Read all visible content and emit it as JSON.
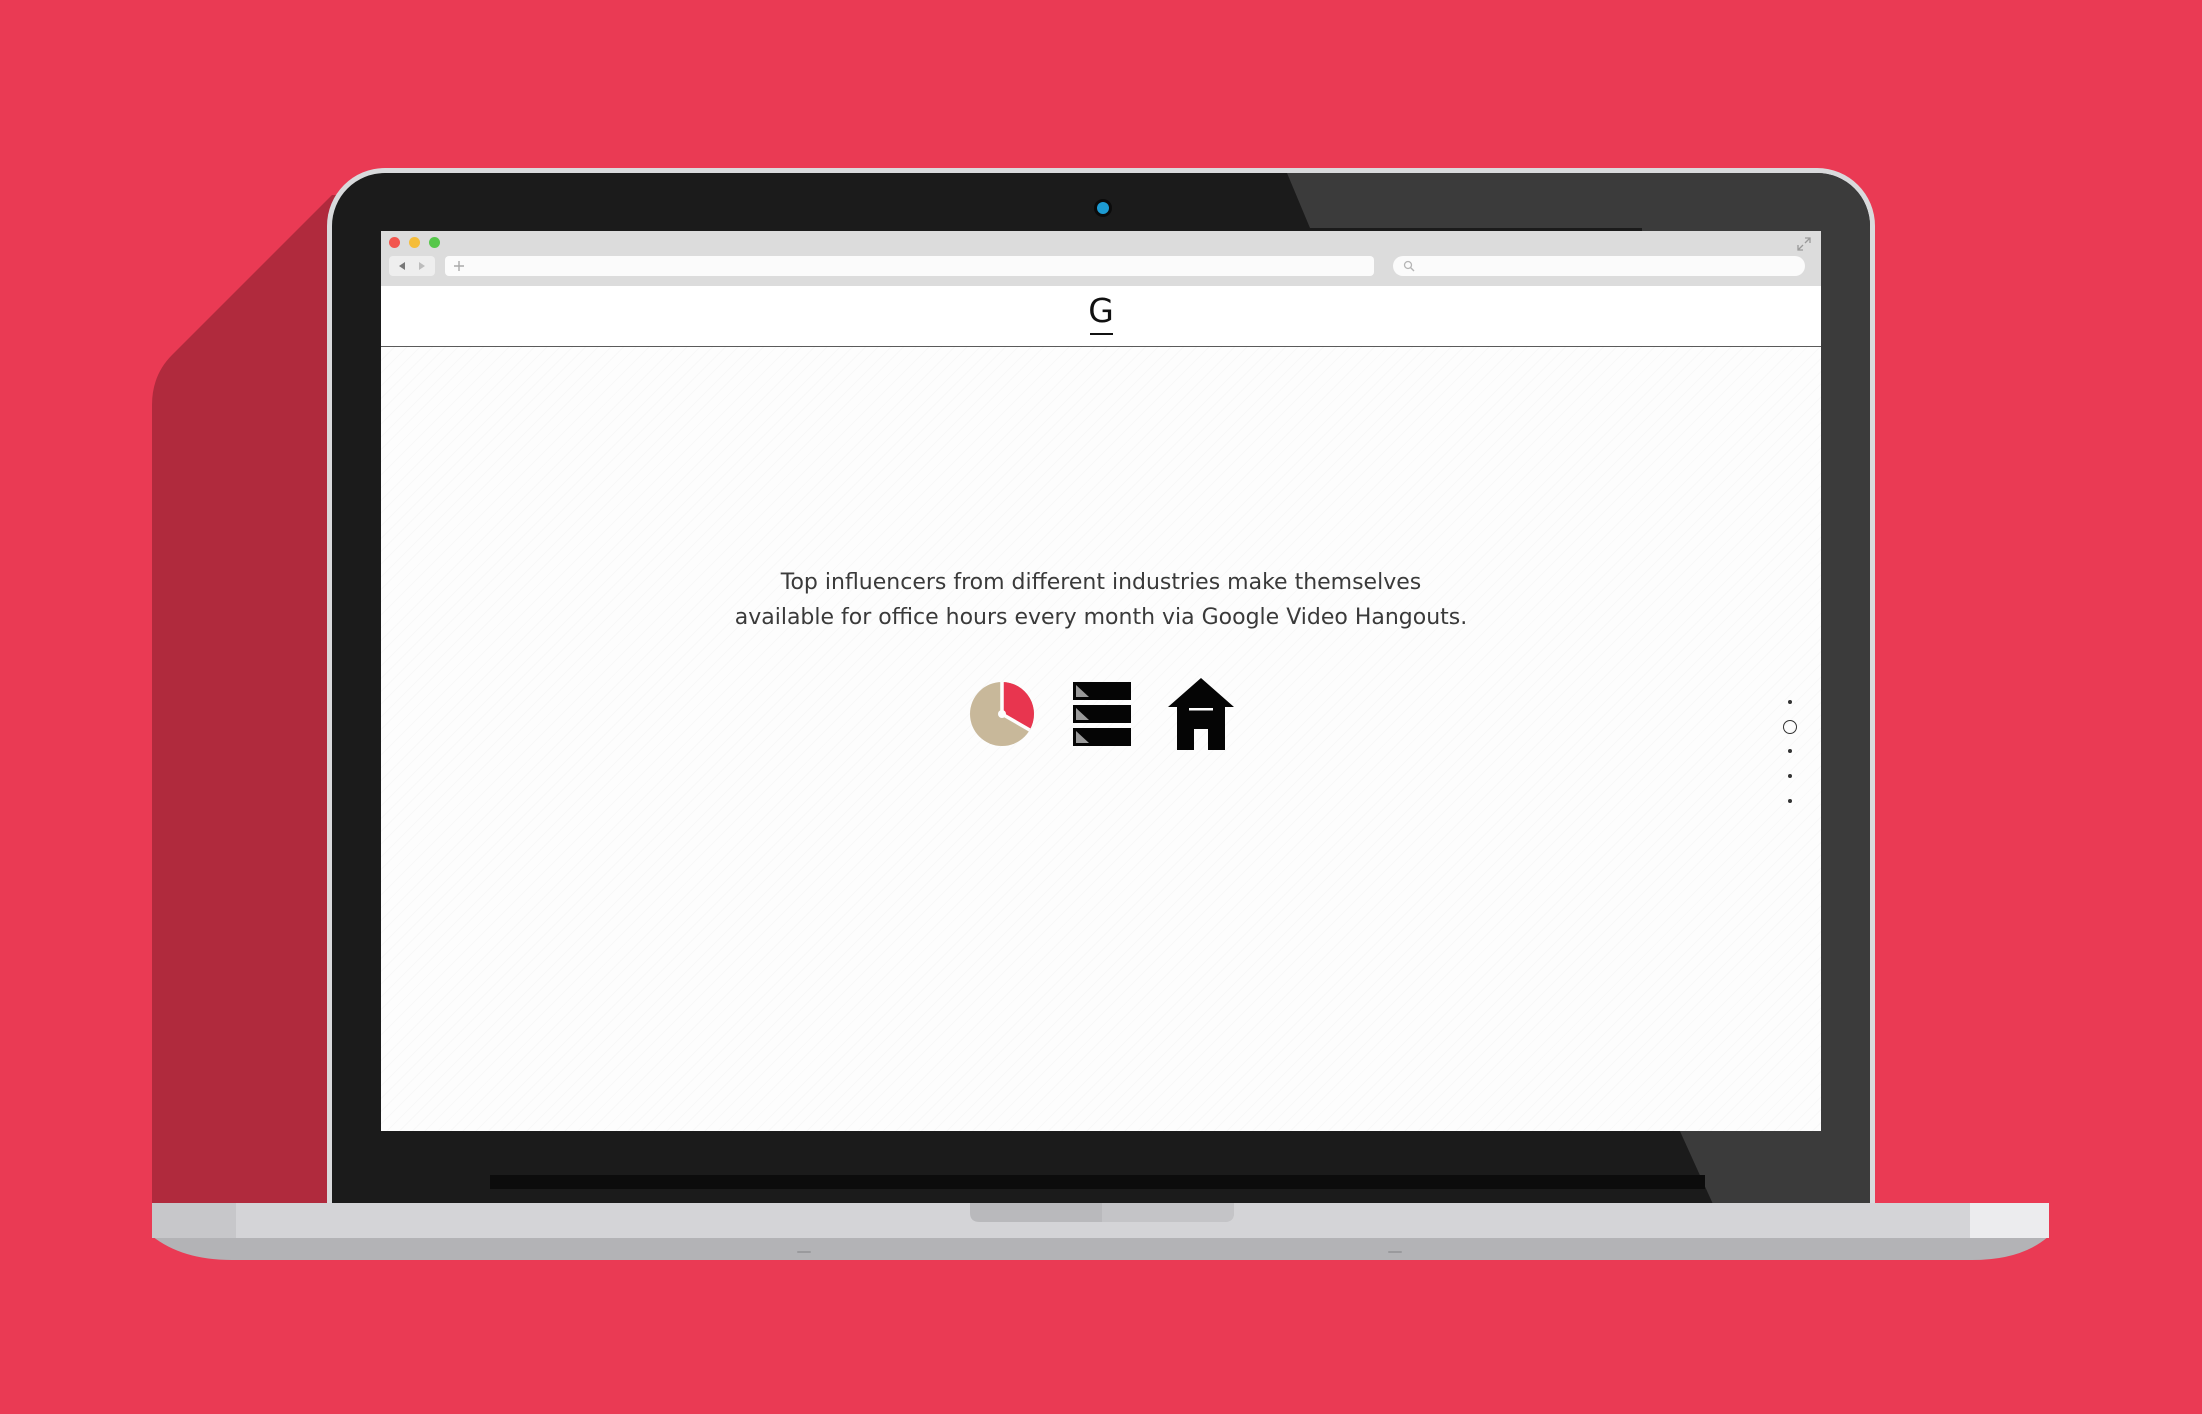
{
  "browser": {
    "address_bar": "",
    "search_bar": ""
  },
  "site": {
    "logo": "G"
  },
  "hero": {
    "tagline_line1": "Top influencers from different industries make themselves",
    "tagline_line2": "available for office hours every month via Google Video Hangouts."
  },
  "icons": {
    "features": [
      "pie-chart-icon",
      "servers-icon",
      "house-icon"
    ],
    "browser": [
      "back-icon",
      "forward-icon",
      "plus-icon",
      "search-icon",
      "expand-icon"
    ]
  },
  "pagination": {
    "count": 5,
    "active_index": 1
  },
  "colors": {
    "background": "#ea3a54",
    "chart_tan": "#c8b89a",
    "chart_red": "#e8354f",
    "camera": "#1d9bd3",
    "traffic_red": "#f2554e",
    "traffic_yellow": "#f5bd3a",
    "traffic_green": "#56c74a"
  }
}
